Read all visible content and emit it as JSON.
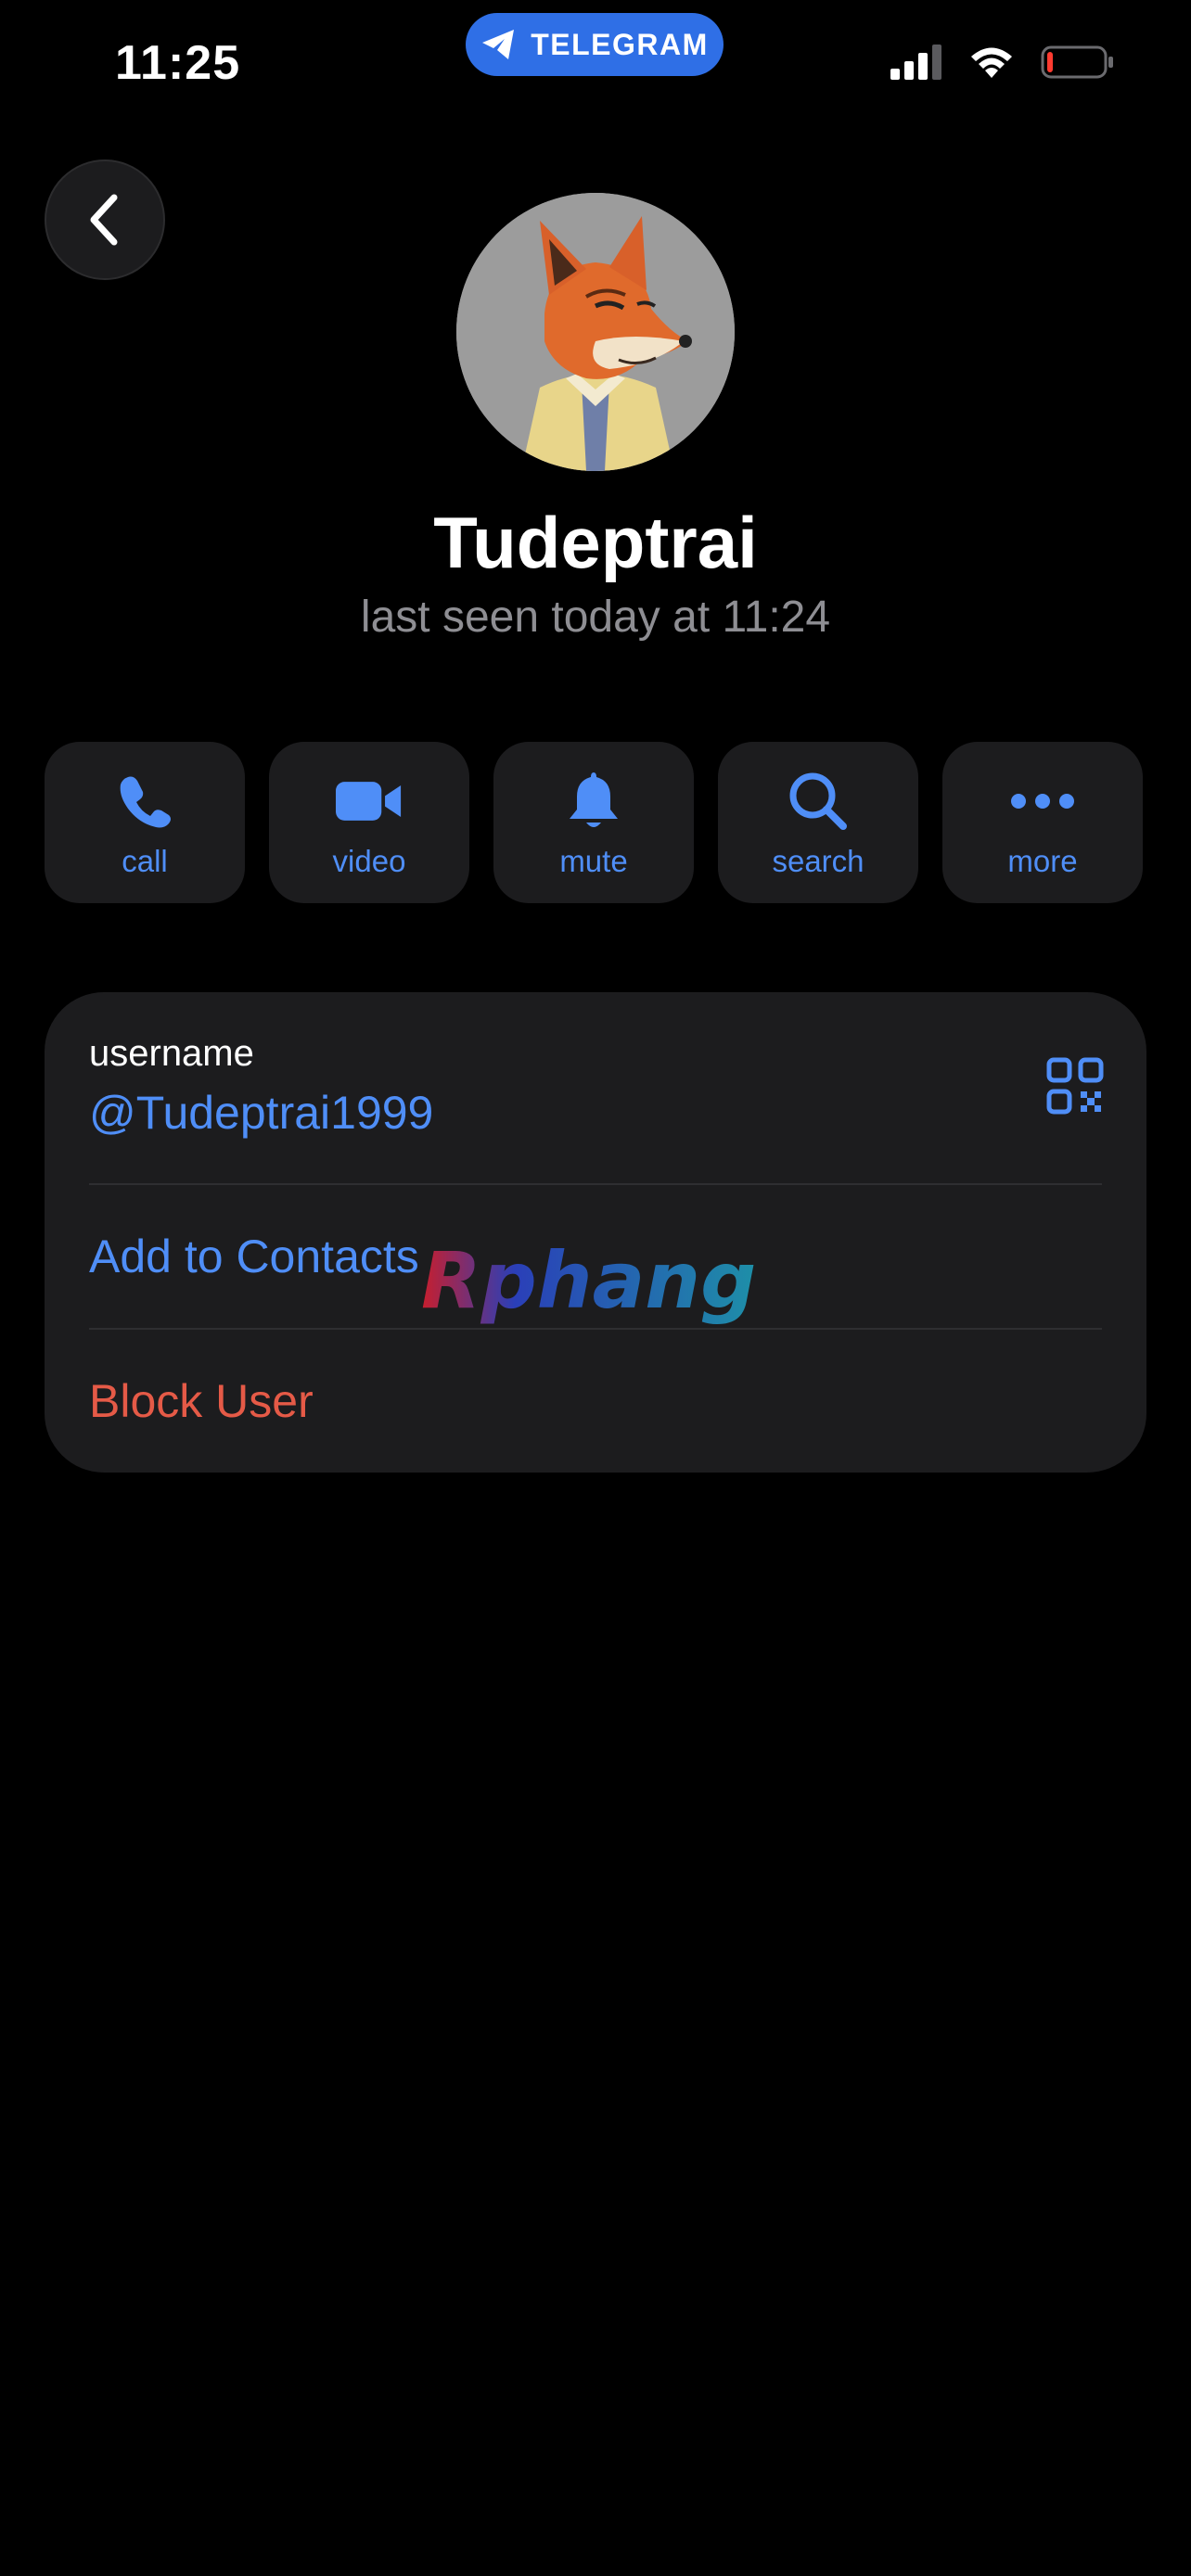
{
  "status_bar": {
    "time": "11:25",
    "app_pill_label": "TELEGRAM",
    "icons": [
      "telegram-icon",
      "cellular-signal-icon",
      "wifi-icon",
      "battery-low-icon"
    ],
    "battery_level": 0.1
  },
  "navigation": {
    "back_icon": "chevron-left-icon"
  },
  "profile": {
    "name": "Tudeptrai",
    "status": "last seen today at 11:24",
    "avatar": "fox-avatar"
  },
  "actions": [
    {
      "label": "call",
      "icon": "phone-icon"
    },
    {
      "label": "video",
      "icon": "video-camera-icon"
    },
    {
      "label": "mute",
      "icon": "bell-icon"
    },
    {
      "label": "search",
      "icon": "search-icon"
    },
    {
      "label": "more",
      "icon": "more-dots-icon"
    }
  ],
  "info": {
    "username_label": "username",
    "username_value": "@Tudeptrai1999",
    "qr_icon": "qr-code-icon",
    "add_contact_label": "Add to Contacts",
    "block_label": "Block User"
  },
  "watermark": {
    "text": "Rphang"
  },
  "colors": {
    "background": "#000000",
    "surface": "#1c1c1e",
    "accent": "#4f8ef7",
    "destructive": "#e55a47",
    "secondary_text": "#8e8e93",
    "pill": "#2f6fe6"
  }
}
